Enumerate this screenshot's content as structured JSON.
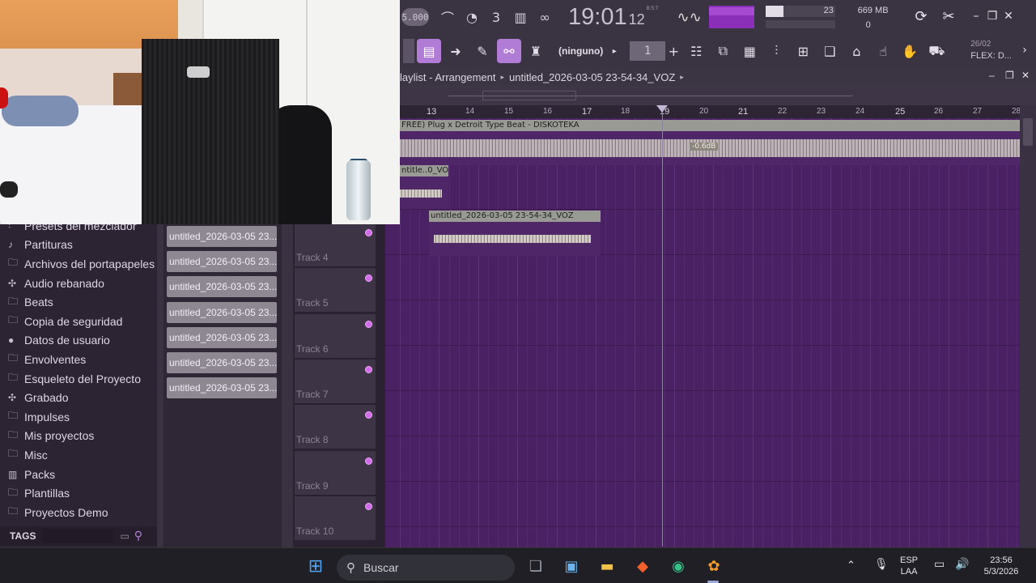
{
  "toolbar": {
    "tempo": "5.000",
    "time_main": "19:01",
    "time_sub": "12",
    "time_mode": "B:S:T",
    "cpu_value": "23",
    "memory": "669 MB",
    "polyphony": "0",
    "snap": "(ninguno)",
    "step_value": "1",
    "news_date": "26/02",
    "news_text": "FLEX: D..."
  },
  "playlist": {
    "breadcrumb_title": "laylist - Arrangement",
    "project_name": "untitled_2026-03-05 23-54-34_VOZ",
    "ruler": [
      "13",
      "14",
      "15",
      "16",
      "17",
      "18",
      "19",
      "20",
      "21",
      "22",
      "23",
      "24",
      "25",
      "26",
      "27",
      "28"
    ],
    "clips": [
      {
        "title": "FREE) Plug x Detroit Type Beat - DISKOTEKA",
        "db": "-0.6dB"
      },
      {
        "title": "ntitle..0_VOZ"
      },
      {
        "title": "untitled_2026-03-05 23-54-34_VOZ"
      }
    ]
  },
  "browser": {
    "items": [
      {
        "label": "Presets del mezclador",
        "icon": "mixer-icon"
      },
      {
        "label": "Partituras",
        "icon": "note-icon"
      },
      {
        "label": "Archivos del portapapeles",
        "icon": "folder-icon"
      },
      {
        "label": "Audio rebanado",
        "icon": "slice-icon"
      },
      {
        "label": "Beats",
        "icon": "folder-icon"
      },
      {
        "label": "Copia de seguridad",
        "icon": "backup-folder-icon"
      },
      {
        "label": "Datos de usuario",
        "icon": "user-icon"
      },
      {
        "label": "Envolventes",
        "icon": "folder-icon"
      },
      {
        "label": "Esqueleto del Proyecto",
        "icon": "folder-icon"
      },
      {
        "label": "Grabado",
        "icon": "record-icon"
      },
      {
        "label": "Impulses",
        "icon": "folder-icon"
      },
      {
        "label": "Mis proyectos",
        "icon": "folder-icon"
      },
      {
        "label": "Misc",
        "icon": "folder-icon"
      },
      {
        "label": "Packs",
        "icon": "packs-icon"
      },
      {
        "label": "Plantillas",
        "icon": "folder-icon"
      },
      {
        "label": "Proyectos Demo",
        "icon": "folder-icon"
      }
    ],
    "tags_label": "TAGS"
  },
  "picker": {
    "patterns": [
      "untitled_2026-03-05 23...",
      "untitled_2026-03-05 23...",
      "untitled_2026-03-05 23...",
      "untitled_2026-03-05 23...",
      "untitled_2026-03-05 23...",
      "untitled_2026-03-05 23...",
      "untitled_2026-03-05 23..."
    ]
  },
  "tracks": [
    "Track 4",
    "Track 5",
    "Track 6",
    "Track 7",
    "Track 8",
    "Track 9",
    "Track 10"
  ],
  "taskbar": {
    "search_placeholder": "Buscar",
    "lang": "ESP",
    "lang_sub": "LAA",
    "time": "23:56",
    "date": "5/3/2026"
  },
  "colors": {
    "accent": "#b07cd6",
    "grid": "#4a2163",
    "clip_title": "#9a9a94",
    "track_dot": "#d36ce8"
  }
}
